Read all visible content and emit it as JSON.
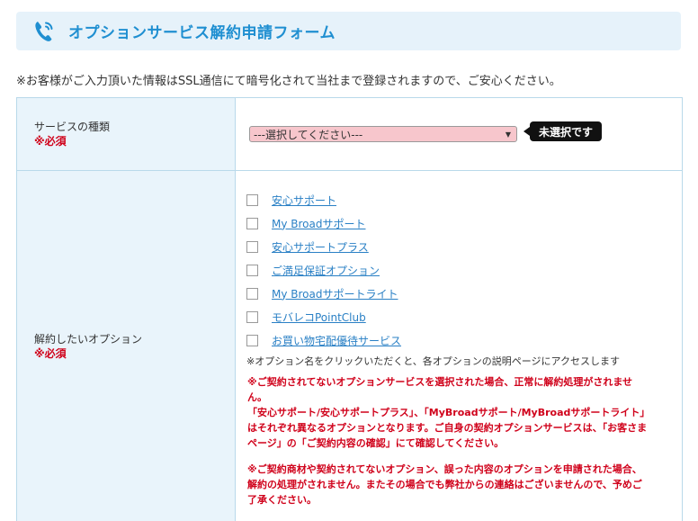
{
  "header": {
    "title": "オプションサービス解約申請フォーム",
    "icon": "phone-icon",
    "accent": "#1f8fd1"
  },
  "notice": "※お客様がご入力頂いた情報はSSL通信にて暗号化されて当社まで登録されますので、ご安心ください。",
  "form": {
    "service_type": {
      "label": "サービスの種類",
      "required": "※必須",
      "select_value": "---選択してください---",
      "tooltip": "未選択です"
    },
    "options": {
      "label": "解約したいオプション",
      "required": "※必須",
      "items": [
        {
          "label": "安心サポート",
          "checked": false
        },
        {
          "label": "My Broadサポート",
          "checked": false
        },
        {
          "label": "安心サポートプラス",
          "checked": false
        },
        {
          "label": "ご満足保証オプション",
          "checked": false
        },
        {
          "label": "My Broadサポートライト",
          "checked": false
        },
        {
          "label": "モバレコPointClub",
          "checked": false
        },
        {
          "label": "お買い物宅配優待サービス",
          "checked": false
        }
      ],
      "hint": "※オプション名をクリックいただくと、各オプションの説明ページにアクセスします",
      "warning1_line1": "※ご契約されてないオプションサービスを選択された場合、正常に解約処理がされません。",
      "warning1_line2": "「安心サポート/安心サポートプラス」、「MyBroadサポート/MyBroadサポートライト」はそれぞれ異なるオプションとなります。ご自身の契約オプションサービスは、「お客さまページ」の「ご契約内容の確認」にて確認してください。",
      "warning2": "※ご契約商材や契約されてないオプション、誤った内容のオプションを申請された場合、解約の処理がされません。またその場合でも弊社からの連絡はございませんので、予めご了承ください。"
    }
  },
  "colors": {
    "label_bg": "#e9f4fb",
    "border": "#b9d9ea",
    "required": "#d0021b",
    "select_bg": "#f7c6cc",
    "link": "#2a80c5"
  }
}
